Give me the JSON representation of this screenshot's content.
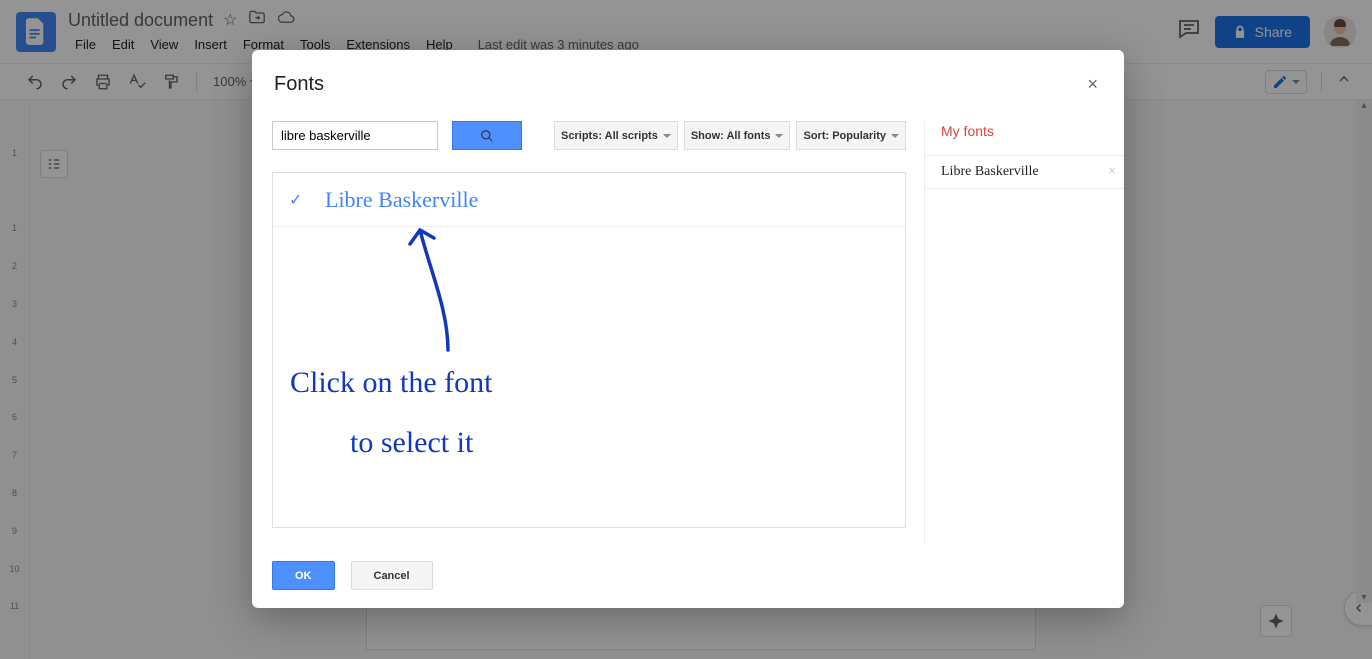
{
  "header": {
    "doc_title": "Untitled document",
    "last_edit": "Last edit was 3 minutes ago",
    "share_label": "Share",
    "menu": [
      "File",
      "Edit",
      "View",
      "Insert",
      "Format",
      "Tools",
      "Extensions",
      "Help"
    ]
  },
  "toolbar": {
    "zoom": "100%"
  },
  "dialog": {
    "title": "Fonts",
    "search_value": "libre baskerville",
    "filters": {
      "scripts": "Scripts: All scripts",
      "show": "Show: All fonts",
      "sort": "Sort: Popularity"
    },
    "result_font": "Libre Baskerville",
    "my_fonts_title": "My fonts",
    "my_fonts": [
      "Libre Baskerville"
    ],
    "ok_label": "OK",
    "cancel_label": "Cancel"
  },
  "annotation": {
    "line1": "Click on the font",
    "line2": "to select it"
  },
  "ruler_v": [
    "",
    "1",
    "",
    "1",
    "2",
    "3",
    "4",
    "5",
    "6",
    "7",
    "8",
    "9",
    "10",
    "11"
  ]
}
